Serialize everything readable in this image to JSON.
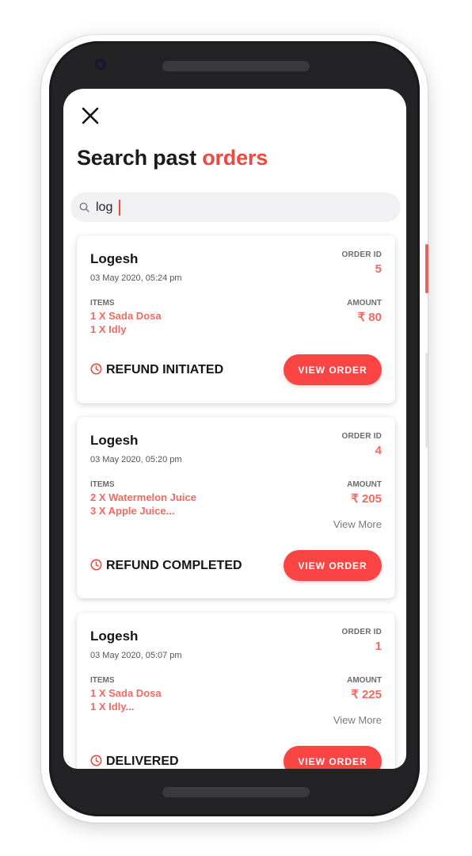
{
  "page": {
    "title_main": "Search past ",
    "title_accent": "orders"
  },
  "search": {
    "query": "log"
  },
  "view_order_label": "VIEW ORDER",
  "order_id_label": "ORDER ID",
  "items_label": "ITEMS",
  "amount_label": "AMOUNT",
  "view_more_label": "View More",
  "colors": {
    "accent": "#f0473f",
    "button": "#fb4545",
    "item_text": "#ef6a62"
  },
  "orders": [
    {
      "name": "Logesh",
      "date": "03 May 2020, 05:24 pm",
      "order_id": "5",
      "items": [
        "1 X Sada Dosa",
        "1 X Idly"
      ],
      "amount": "₹ 80",
      "status": "REFUND INITIATED"
    },
    {
      "name": "Logesh",
      "date": "03 May 2020, 05:20 pm",
      "order_id": "4",
      "items": [
        "2 X Watermelon Juice",
        "3 X Apple Juice..."
      ],
      "amount": "₹ 205",
      "status": "REFUND COMPLETED"
    },
    {
      "name": "Logesh",
      "date": "03 May 2020, 05:07 pm",
      "order_id": "1",
      "items": [
        "1 X Sada Dosa",
        "1 X Idly..."
      ],
      "amount": "₹ 225",
      "status": "DELIVERED"
    }
  ]
}
